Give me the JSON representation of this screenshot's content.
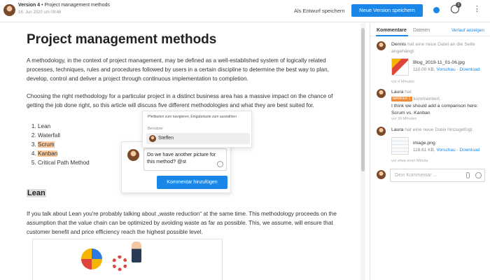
{
  "header": {
    "version_label": "Version 4",
    "doc_title": "Project management methods",
    "date": "16. Jun 2020 um 09:48",
    "save_draft": "Als Entwurf speichern",
    "save_version": "Neue Version speichern",
    "notif_count": "1"
  },
  "article": {
    "title": "Project management methods",
    "para1": "A methodology, in the context of project management, may be defined as a well-established system of logically related processes, techniques, rules and procedures followed by users in a certain discipline to determine the best way to plan, develop, control and deliver a project through continuous implementation to completion.",
    "para2": "Choosing the right methodology for a particular project in a distinct business area has a massive impact on the chance of getting the job done right, so this article will discuss five different methodologies and what they are best suited for.",
    "list": [
      "Lean",
      "Waterfall",
      "Scrum",
      "Kanban",
      "Critical Path Method"
    ],
    "highlighted": [
      "Scrum",
      "Kanban"
    ],
    "section_heading": "Lean",
    "para3": "If you talk about Lean you're probably talking about „waste reduction“ at the same time. This methodology proceeds on the assumption that the value chain can be optimized by avoiding waste as far as possible. This, we assume, will ensure that customer benefit and price efficiency reach the highest possible level."
  },
  "mention_popup": {
    "hint": "Pfeiltasten zum navigieren, Eingabetaste zum auswählen",
    "group": "Benutzer",
    "user": "Steffen"
  },
  "comment_box": {
    "text": "Do we have another picture for this method? @st",
    "button": "Kommentar hinzufügen"
  },
  "sidebar": {
    "tab_comments": "Kommentare",
    "tab_files": "Dateien",
    "history_link": "Verlauf anzeigen",
    "entries": [
      {
        "user": "Dennis",
        "action": "hat eine neue Datei an die Seite angehängt.",
        "file_name": "Blog_2019-11_01-06.jpg",
        "file_size": "110.00 KB,",
        "preview": "Vorschau",
        "download": "Download",
        "time": "vor 4 Minuten"
      },
      {
        "user": "Laura",
        "action_prefix": "hat",
        "marker": "MARKER 1",
        "action": "kommentiert.",
        "comment": "I think we should add a comparison here: Scrum vs. Kanban",
        "time": "vor 39 Minuten"
      },
      {
        "user": "Laura",
        "action": "hat eine neue Datei hinzugefügt.",
        "file_name": "image.png",
        "file_size": "118.61 KB,",
        "preview": "Vorschau",
        "download": "Download",
        "time": "vor etwa einer Minute"
      }
    ],
    "comment_placeholder": "Dein Kommentar ..."
  },
  "icons": [
    "avatar",
    "notification-icon",
    "more-icon",
    "paperclip-icon",
    "smiley-icon",
    "file-thumbnail-icon"
  ],
  "colors": {
    "accent": "#1a86e8",
    "highlight": "#fbc99b",
    "marker": "#f08b3a"
  }
}
